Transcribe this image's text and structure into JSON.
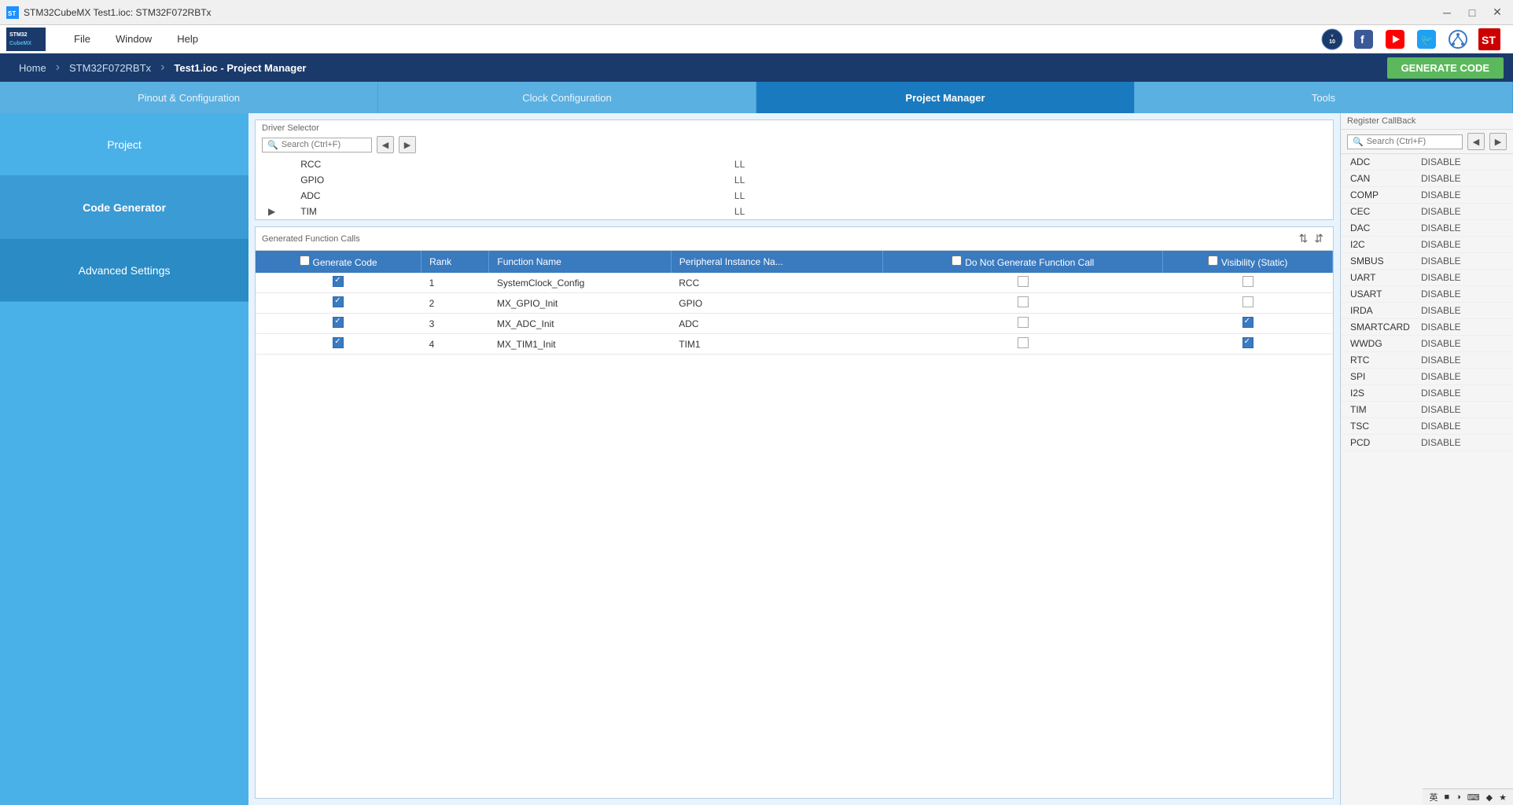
{
  "titleBar": {
    "title": "STM32CubeMX Test1.ioc: STM32F072RBTx",
    "minimizeLabel": "─",
    "maximizeLabel": "□",
    "closeLabel": "✕"
  },
  "menuBar": {
    "logo": "STM32\nCubeMX",
    "items": [
      "File",
      "Window",
      "Help"
    ],
    "icons": [
      "social-fb",
      "social-yt",
      "social-tw",
      "social-star",
      "social-st"
    ]
  },
  "breadcrumb": {
    "items": [
      "Home",
      "STM32F072RBTx",
      "Test1.ioc - Project Manager"
    ],
    "generateCode": "GENERATE CODE"
  },
  "tabs": [
    {
      "label": "Pinout & Configuration",
      "active": false
    },
    {
      "label": "Clock Configuration",
      "active": false
    },
    {
      "label": "Project Manager",
      "active": true
    },
    {
      "label": "Tools",
      "active": false
    }
  ],
  "sidebar": {
    "items": [
      {
        "label": "Project",
        "active": false
      },
      {
        "label": "Code Generator",
        "active": true
      },
      {
        "label": "Advanced Settings",
        "active": false
      }
    ]
  },
  "driverSelector": {
    "sectionTitle": "Driver Selector",
    "searchPlaceholder": "Search (Ctrl+F)",
    "drivers": [
      {
        "name": "RCC",
        "type": "LL",
        "expandable": false
      },
      {
        "name": "GPIO",
        "type": "LL",
        "expandable": false
      },
      {
        "name": "ADC",
        "type": "LL",
        "expandable": false
      },
      {
        "name": "TIM",
        "type": "LL",
        "expandable": true
      }
    ]
  },
  "generatedFunctionCalls": {
    "sectionTitle": "Generated Function Calls",
    "columns": [
      "Generate Code",
      "Rank",
      "Function Name",
      "Peripheral Instance Na...",
      "Do Not Generate Function Call",
      "Visibility (Static)"
    ],
    "rows": [
      {
        "generateCode": true,
        "rank": 1,
        "functionName": "SystemClock_Config",
        "peripheral": "RCC",
        "doNotGenerate": false,
        "visibility": false
      },
      {
        "generateCode": true,
        "rank": 2,
        "functionName": "MX_GPIO_Init",
        "peripheral": "GPIO",
        "doNotGenerate": false,
        "visibility": false
      },
      {
        "generateCode": true,
        "rank": 3,
        "functionName": "MX_ADC_Init",
        "peripheral": "ADC",
        "doNotGenerate": false,
        "visibility": true
      },
      {
        "generateCode": true,
        "rank": 4,
        "functionName": "MX_TIM1_Init",
        "peripheral": "TIM1",
        "doNotGenerate": false,
        "visibility": true
      }
    ]
  },
  "registerCallBack": {
    "sectionTitle": "Register CallBack",
    "searchPlaceholder": "Search (Ctrl+F)",
    "items": [
      {
        "name": "ADC",
        "status": "DISABLE"
      },
      {
        "name": "CAN",
        "status": "DISABLE"
      },
      {
        "name": "COMP",
        "status": "DISABLE"
      },
      {
        "name": "CEC",
        "status": "DISABLE"
      },
      {
        "name": "DAC",
        "status": "DISABLE"
      },
      {
        "name": "I2C",
        "status": "DISABLE"
      },
      {
        "name": "SMBUS",
        "status": "DISABLE"
      },
      {
        "name": "UART",
        "status": "DISABLE"
      },
      {
        "name": "USART",
        "status": "DISABLE"
      },
      {
        "name": "IRDA",
        "status": "DISABLE"
      },
      {
        "name": "SMARTCARD",
        "status": "DISABLE"
      },
      {
        "name": "WWDG",
        "status": "DISABLE"
      },
      {
        "name": "RTC",
        "status": "DISABLE"
      },
      {
        "name": "SPI",
        "status": "DISABLE"
      },
      {
        "name": "I2S",
        "status": "DISABLE"
      },
      {
        "name": "TIM",
        "status": "DISABLE"
      },
      {
        "name": "TSC",
        "status": "DISABLE"
      },
      {
        "name": "PCD",
        "status": "DISABLE"
      }
    ]
  },
  "statusBar": {
    "items": [
      "英",
      "■",
      "◐",
      "⌨",
      "♦",
      "★"
    ]
  }
}
